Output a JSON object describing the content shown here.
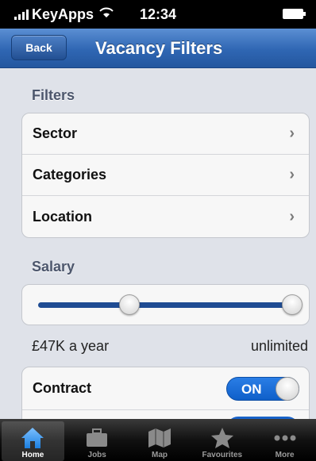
{
  "status_bar": {
    "carrier": "KeyApps",
    "time": "12:34"
  },
  "nav": {
    "back_label": "Back",
    "title": "Vacancy Filters"
  },
  "filters": {
    "header": "Filters",
    "items": [
      {
        "label": "Sector"
      },
      {
        "label": "Categories"
      },
      {
        "label": "Location"
      }
    ]
  },
  "salary": {
    "header": "Salary",
    "min_label": "£47K a year",
    "max_label": "unlimited",
    "min_position": 0.36,
    "max_position": 1.0
  },
  "contract": {
    "label": "Contract",
    "toggle_label": "ON",
    "on": true
  },
  "tabs": [
    {
      "label": "Home",
      "icon": "home-icon",
      "active": true
    },
    {
      "label": "Jobs",
      "icon": "briefcase-icon",
      "active": false
    },
    {
      "label": "Map",
      "icon": "map-icon",
      "active": false
    },
    {
      "label": "Favourites",
      "icon": "star-icon",
      "active": false
    },
    {
      "label": "More",
      "icon": "more-icon",
      "active": false
    }
  ],
  "colors": {
    "nav_blue": "#2f66b3",
    "slider_fill": "#1f4c93",
    "toggle_on": "#1766d0",
    "background": "#dfe2e9"
  }
}
